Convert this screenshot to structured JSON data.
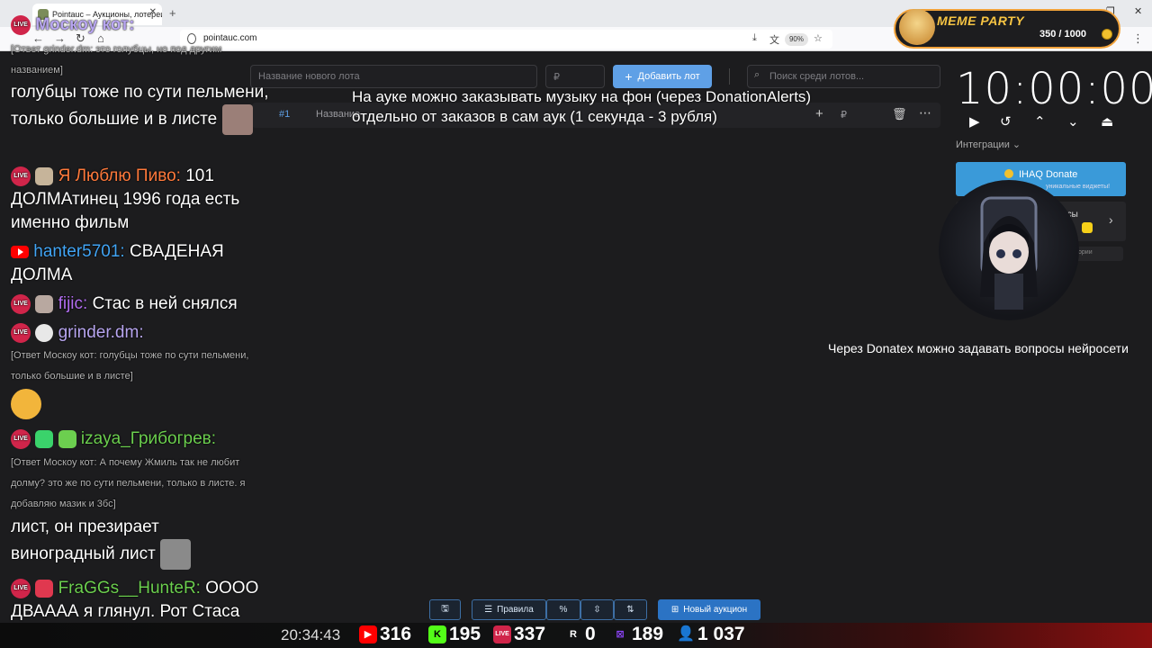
{
  "browser": {
    "tab_title": "Pointauc – Аукционы, лотереи",
    "url": "pointauc.com",
    "zoom": "90%"
  },
  "app": {
    "new_lot_placeholder": "Название нового лота",
    "currency": "₽",
    "add_lot_label": "Добавить лот",
    "search_placeholder": "Поиск среди лотов...",
    "lot_row": {
      "index": "#1",
      "name_placeholder": "Название",
      "currency": "₽"
    },
    "timer": "10:00:00",
    "integrations_label": "Интеграции",
    "ihaq_title": "IHAQ Donate",
    "ihaq_sub": "уникальные виджеты!",
    "card2_label": "исы",
    "card3_label": "ории",
    "toolbar": {
      "rules": "Правила",
      "new_auction": "Новый аукцион"
    }
  },
  "overlay": {
    "announcement_line1": "На ауке можно заказывать музыку на фон (через DonationAlerts)",
    "announcement_line2": "отдельно от заказов в сам аук (1 секунда - 3 рубля)",
    "donatex_note": "Через Donatex можно задавать вопросы нейросети",
    "meme_party": {
      "title": "MEME PARTY",
      "progress_text": "350 / 1000",
      "current": 350,
      "goal": 1000
    }
  },
  "chat": {
    "live_badge": "LIVE",
    "messages": [
      {
        "user": "Москоу кот:",
        "text": ""
      },
      {
        "reply": "[Ответ grinder.dm: это голубцы, но под другим названием]"
      },
      {
        "text": "голубцы тоже по сути пельмени, только большие и в листе"
      },
      {
        "user": "Я Люблю Пиво:",
        "text": "101 ДОЛМАтинец 1996 года есть именно фильм"
      },
      {
        "user": "hanter5701:",
        "text": "СВАДЕНАЯ ДОЛМА"
      },
      {
        "user": "fijic:",
        "text": "Стас в ней снялся"
      },
      {
        "user": "grinder.dm:",
        "text": ""
      },
      {
        "reply": "[Ответ Москоу кот: голубцы тоже по сути пельмени, только большие и в листе]"
      },
      {
        "user": "izaya_Грибогрев:",
        "text": ""
      },
      {
        "reply": "[Ответ Москоу кот: А почему Жмиль так не любит долму? это же по сути пельмени, только в листе. я добавляю мазик и 3бс]"
      },
      {
        "text": "лист, он презирает виноградный лист"
      },
      {
        "user": "FraGGs__HunteR:",
        "text": "ОООО ДВАААА я глянул. Рот Стаса ебал нахуй"
      }
    ]
  },
  "stats": {
    "clock": "20:34:43",
    "youtube": "316",
    "kick": "195",
    "vk": "337",
    "rumble": "0",
    "twitch": "189",
    "total": "1 037"
  },
  "colors": {
    "accent_blue": "#5fa0e6",
    "live_red": "#d0254a",
    "meme_gold": "#f6c443",
    "name_orange": "#ff7a3c",
    "name_blue": "#42a5f5",
    "name_purple": "#b26ef0",
    "name_green": "#6ccf4f",
    "name_lavender": "#b8a6f0"
  }
}
